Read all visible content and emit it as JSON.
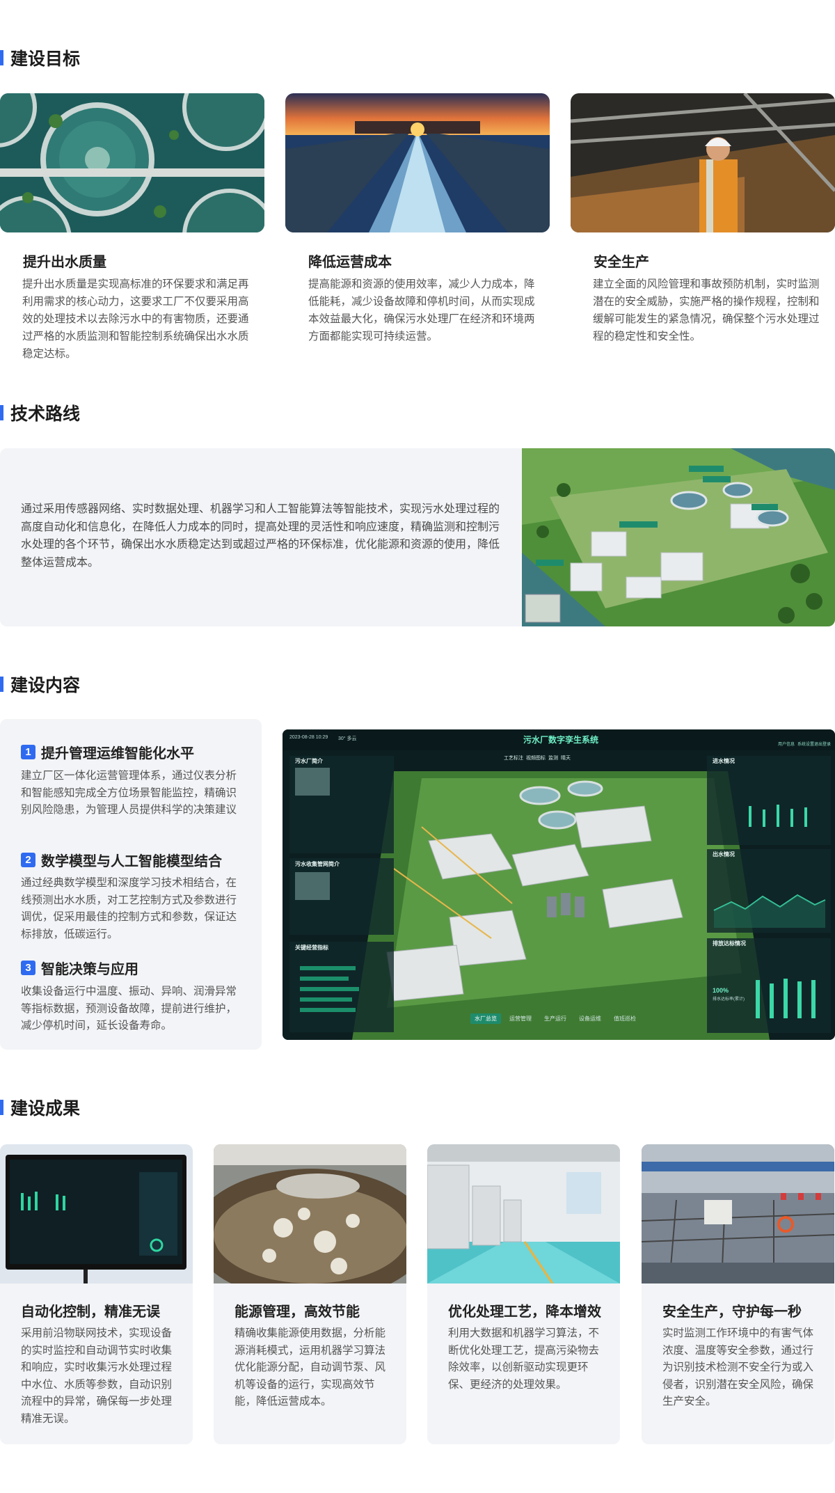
{
  "sections": {
    "goals_title": "建设目标",
    "route_title": "技术路线",
    "content_title": "建设内容",
    "results_title": "建设成果"
  },
  "goals": [
    {
      "title": "提升出水质量",
      "text": "提升出水质量是实现高标准的环保要求和满足再利用需求的核心动力，这要求工厂不仅要采用高效的处理技术以去除污水中的有害物质，还要通过严格的水质监测和智能控制系统确保出水水质稳定达标。"
    },
    {
      "title": "降低运营成本",
      "text": "提高能源和资源的使用效率，减少人力成本，降低能耗，减少设备故障和停机时间，从而实现成本效益最大化，确保污水处理厂在经济和环境两方面都能实现可持续运营。"
    },
    {
      "title": "安全生产",
      "text": "建立全面的风险管理和事故预防机制，实时监测潜在的安全威胁，实施严格的操作规程，控制和缓解可能发生的紧急情况，确保整个污水处理过程的稳定性和安全性。"
    }
  ],
  "route": {
    "text": "通过采用传感器网络、实时数据处理、机器学习和人工智能算法等智能技术，实现污水处理过程的高度自动化和信息化，在降低人力成本的同时，提高处理的灵活性和响应速度，精确监测和控制污水处理的各个环节，确保出水水质稳定达到或超过严格的环保标准，优化能源和资源的使用，降低整体运营成本。"
  },
  "content": [
    {
      "num": "1",
      "title": "提升管理运维智能化水平",
      "text": "建立厂区一体化运营管理体系，通过仪表分析和智能感知完成全方位场景智能监控，精确识别风险隐患，为管理人员提供科学的决策建议"
    },
    {
      "num": "2",
      "title": "数学模型与人工智能模型结合",
      "text": "通过经典数学模型和深度学习技术相结合，在线预测出水水质，对工艺控制方式及参数进行调优，促采用最佳的控制方式和参数，保证达标排放，低碳运行。"
    },
    {
      "num": "3",
      "title": "智能决策与应用",
      "text": "收集设备运行中温度、振动、异响、润滑异常等指标数据，预测设备故障，提前进行维护，减少停机时间，延长设备寿命。"
    }
  ],
  "dashboard": {
    "title": "污水厂数字孪生系统",
    "datetime": "2023-08-28 10:29",
    "weather": "30° 多云",
    "top_icons": [
      "用户信息",
      "系统设置",
      "退出登录"
    ],
    "panels": {
      "intro": "污水厂简介",
      "network": "污水收集管网简介",
      "indicators": "关键经营指标",
      "inflow": "进水情况",
      "outflow": "出水情况",
      "discharge": "排放达标情况"
    },
    "tabs": [
      "水厂总览",
      "运营管理",
      "生产运行",
      "设备运维",
      "值班巡检"
    ],
    "toggles": [
      "工艺标注",
      "视频图标",
      "监测",
      "晴天"
    ],
    "discharge_value": "100%",
    "discharge_label": "排水达标率(累计)"
  },
  "results": [
    {
      "title": "自动化控制，精准无误",
      "text": "采用前沿物联网技术，实现设备的实时监控和自动调节实时收集和响应，实时收集污水处理过程中水位、水质等参数，自动识别流程中的异常，确保每一步处理精准无误。"
    },
    {
      "title": "能源管理，高效节能",
      "text": "精确收集能源使用数据，分析能源消耗模式，运用机器学习算法优化能源分配，自动调节泵、风机等设备的运行，实现高效节能，降低运营成本。"
    },
    {
      "title": "优化处理工艺，降本增效",
      "text": "利用大数据和机器学习算法，不断优化处理工艺，提高污染物去除效率，以创新驱动实现更环保、更经济的处理效果。"
    },
    {
      "title": "安全生产，守护每一秒",
      "text": "实时监测工作环境中的有害气体浓度、温度等安全参数，通过行为识别技术检测不安全行为或入侵者，识别潜在安全风险，确保生产安全。"
    }
  ]
}
